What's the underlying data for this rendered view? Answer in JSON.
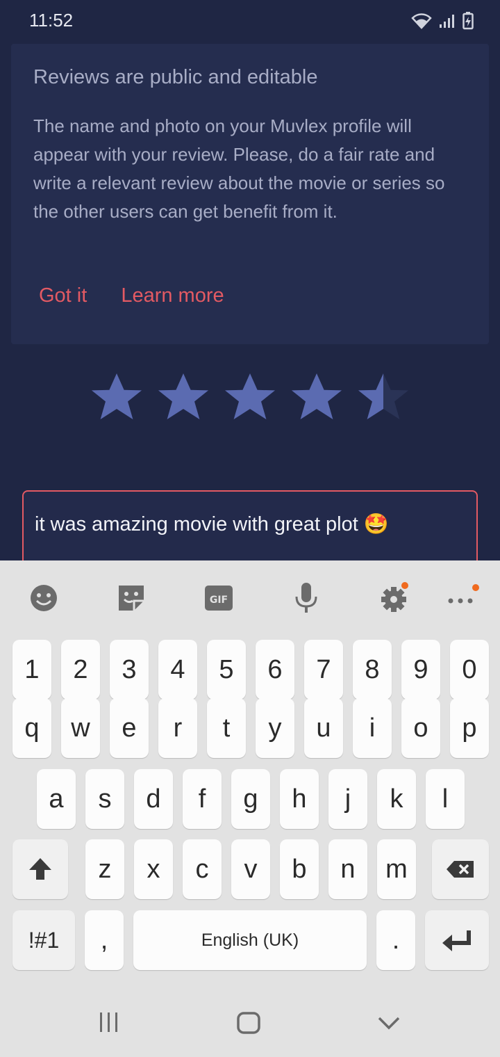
{
  "status": {
    "time": "11:52"
  },
  "card": {
    "title": "Reviews are public and editable",
    "body": "The name and photo on your Muvlex profile will appear with your review. Please, do a fair rate and write a relevant review about the movie or series so the other users can get benefit from it.",
    "got_it": "Got it",
    "learn_more": "Learn more"
  },
  "rating": {
    "value": 4.5,
    "max": 5
  },
  "review": {
    "value": "it was amazing movie with great plot 🤩"
  },
  "keyboard": {
    "row_numbers": [
      "1",
      "2",
      "3",
      "4",
      "5",
      "6",
      "7",
      "8",
      "9",
      "0"
    ],
    "row_top": [
      "q",
      "w",
      "e",
      "r",
      "t",
      "y",
      "u",
      "i",
      "o",
      "p"
    ],
    "row_mid": [
      "a",
      "s",
      "d",
      "f",
      "g",
      "h",
      "j",
      "k",
      "l"
    ],
    "row_bot": [
      "z",
      "x",
      "c",
      "v",
      "b",
      "n",
      "m"
    ],
    "symbols": "!#1",
    "comma": ",",
    "space": "English (UK)",
    "period": ".",
    "gif": "GIF"
  },
  "colors": {
    "accent": "#e35a63",
    "star": "#5b6bb1",
    "background": "#1f2644"
  }
}
